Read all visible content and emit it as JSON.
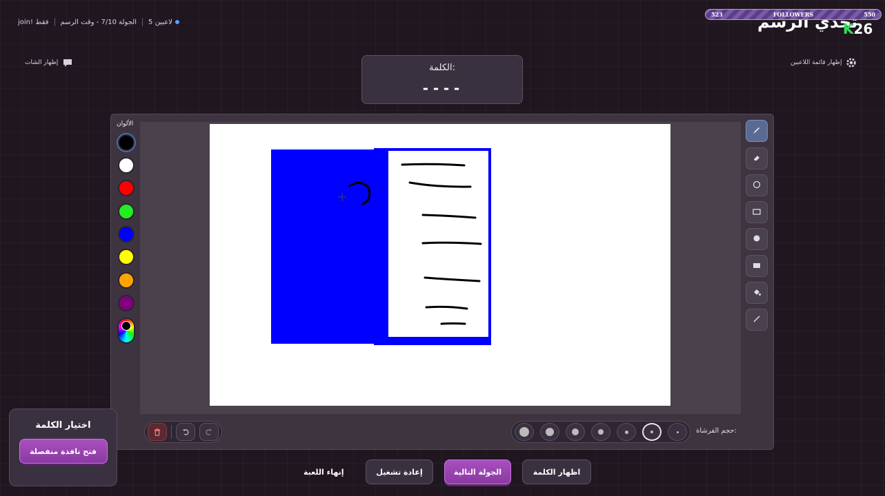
{
  "header": {
    "join_text": "join! فقط",
    "round_text": "الجولة 7/10 - وقت الرسم",
    "players_text": "5 لاعبين",
    "followers": {
      "left": "523",
      "label": "FOLLOWERS",
      "right": "550"
    },
    "game_title": "تحدي الرسم",
    "brand_k": "K",
    "brand_num": "26"
  },
  "toggles": {
    "show_chat": "إظهار الشات",
    "show_players": "إظهار قائمة اللاعبين"
  },
  "word_box": {
    "label": "الكلمة:",
    "blanks": "----"
  },
  "palette": {
    "title": "الألوان",
    "colors": [
      "#000000",
      "#ffffff",
      "#ff0000",
      "#22ee22",
      "#0000ff",
      "#ffff00",
      "#ffa500",
      "#800080"
    ]
  },
  "tools": [
    "brush-icon",
    "eraser-icon",
    "circle-outline-icon",
    "rectangle-outline-icon",
    "circle-filled-icon",
    "rectangle-filled-icon",
    "fill-bucket-icon",
    "line-icon"
  ],
  "bottom": {
    "brush_size_label": "حجم الفرشاة:",
    "selected_size": 2
  },
  "choose_card": {
    "title": "اختيار الكلمة",
    "button": "فتح نافذة منفصلة"
  },
  "actions": {
    "show_word": "اظهار الكلمة",
    "next_round": "الجولة التالية",
    "restart": "إعادة تشغيل",
    "end_game": "إنهاء اللعبة"
  },
  "colors": {
    "accent": "#a94fbf",
    "canvas_blue": "#0000ff"
  }
}
